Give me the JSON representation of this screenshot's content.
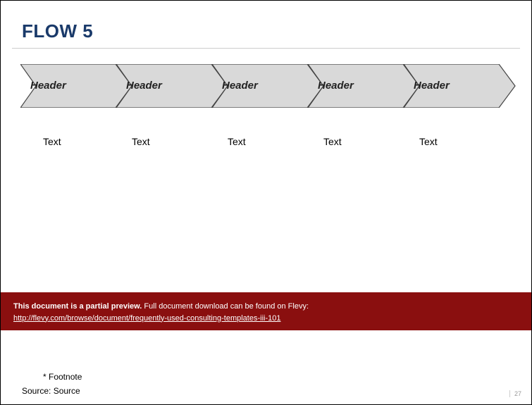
{
  "title": "FLOW 5",
  "flow": {
    "headers": [
      "Header",
      "Header",
      "Header",
      "Header",
      "Header"
    ],
    "texts": [
      "Text",
      "Text",
      "Text",
      "Text",
      "Text"
    ]
  },
  "banner": {
    "bold": "This document is a partial preview.",
    "rest": "  Full document download can be found on Flevy:",
    "link": "http://flevy.com/browse/document/frequently-used-consulting-templates-iii-101"
  },
  "footnote": "* Footnote",
  "source": "Source: Source",
  "page_number": "27"
}
